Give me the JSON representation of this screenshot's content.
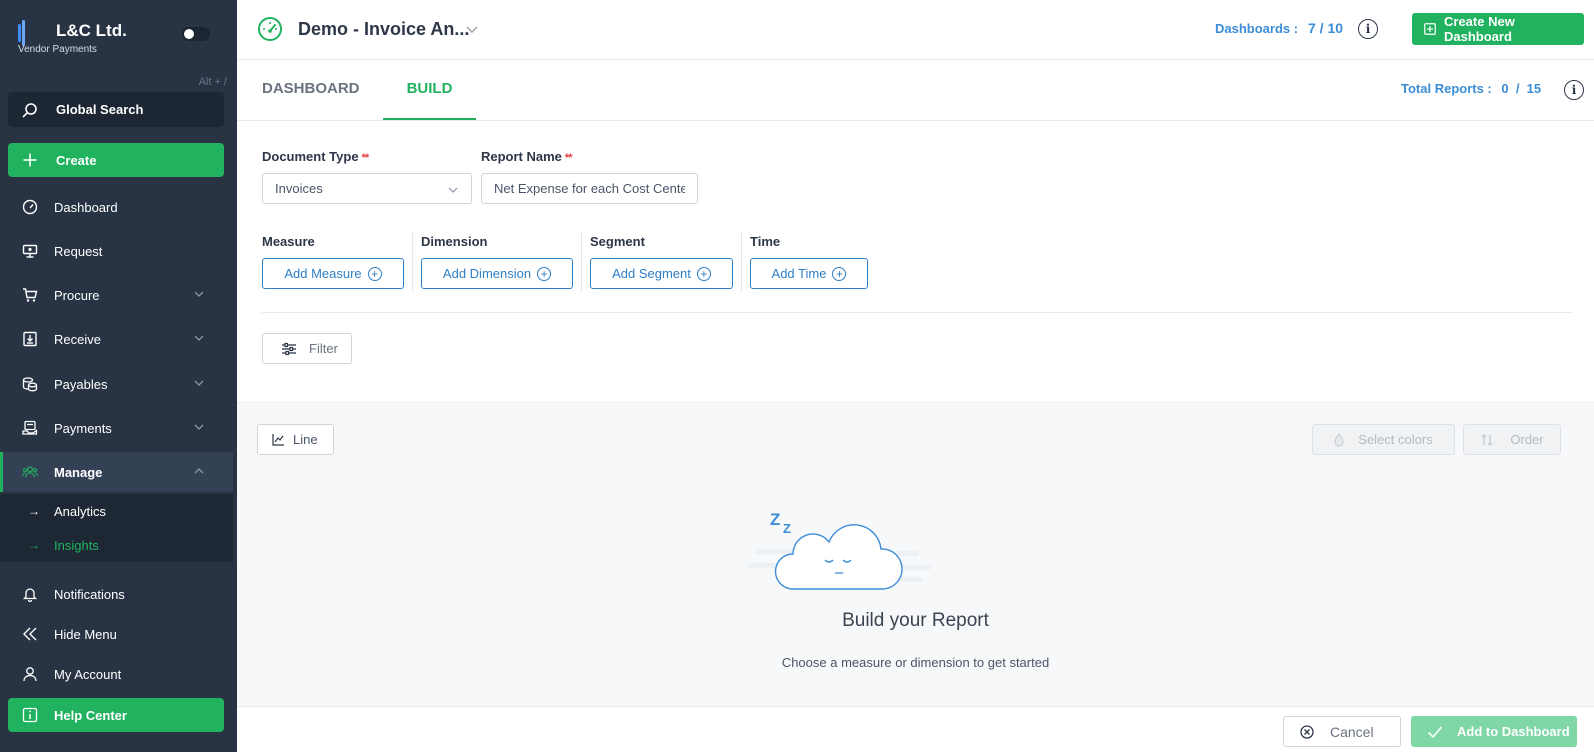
{
  "sidebar": {
    "brand_name": "L&C Ltd.",
    "brand_sub": "Vendor Payments",
    "shortcut_hint": "Alt + /",
    "global_search": "Global Search",
    "create": "Create",
    "items": [
      {
        "label": "Dashboard",
        "icon": "gauge-icon"
      },
      {
        "label": "Request",
        "icon": "request-icon"
      },
      {
        "label": "Procure",
        "icon": "cart-icon"
      },
      {
        "label": "Receive",
        "icon": "receive-icon"
      },
      {
        "label": "Payables",
        "icon": "coins-icon"
      },
      {
        "label": "Payments",
        "icon": "payments-icon"
      },
      {
        "label": "Manage",
        "icon": "users-icon"
      }
    ],
    "manage_sub": [
      {
        "label": "Analytics"
      },
      {
        "label": "Insights"
      }
    ],
    "notifications": "Notifications",
    "hide_menu": "Hide Menu",
    "my_account": "My Account",
    "help_center": "Help Center"
  },
  "header": {
    "title": "Demo - Invoice An...",
    "dashboards_label": "Dashboards :",
    "dashboards_value": "7 / 10",
    "create_dashboard": "Create New Dashboard"
  },
  "tabs": {
    "dashboard": "DASHBOARD",
    "build": "BUILD",
    "total_reports_label": "Total Reports :",
    "total_reports_value": "0  /  15"
  },
  "form": {
    "document_type_label": "Document Type",
    "required_mark": "**",
    "document_type_value": "Invoices",
    "report_name_label": "Report Name",
    "report_name_value": "Net Expense for each Cost Center",
    "measure_label": "Measure",
    "dimension_label": "Dimension",
    "segment_label": "Segment",
    "time_label": "Time",
    "add_measure": "Add Measure",
    "add_dimension": "Add Dimension",
    "add_segment": "Add Segment",
    "add_time": "Add Time",
    "filter": "Filter"
  },
  "chart": {
    "line": "Line",
    "select_colors": "Select colors",
    "order": "Order",
    "empty_title": "Build your Report",
    "empty_sub": "Choose a measure or dimension to get started",
    "sleep_mark": "Z"
  },
  "footer": {
    "cancel": "Cancel",
    "add_to_dashboard": "Add to Dashboard"
  },
  "colors": {
    "accent": "#21b25f",
    "link": "#3b8dd8",
    "sidebar": "#283444"
  }
}
